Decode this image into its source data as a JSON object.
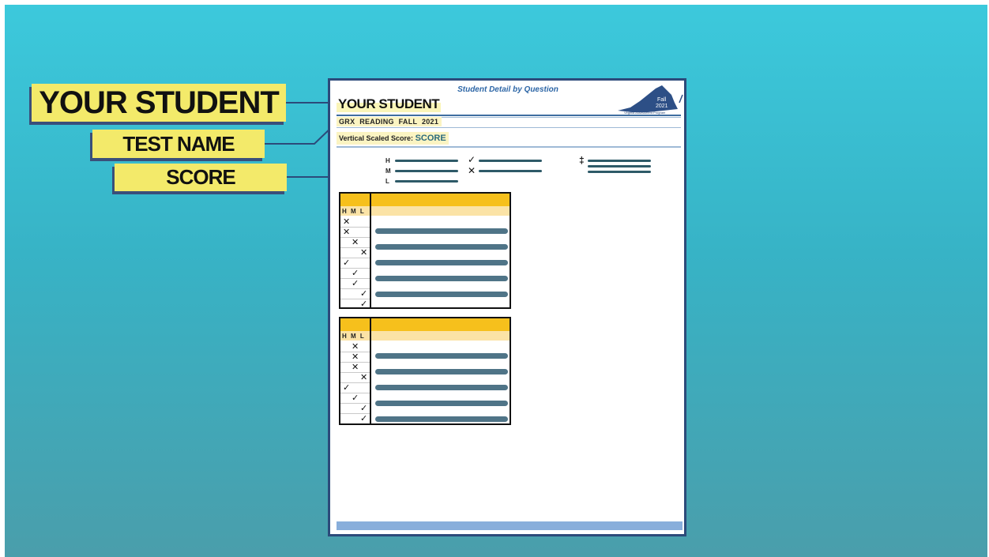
{
  "callouts": {
    "student": "YOUR STUDENT",
    "test_name": "TEST NAME",
    "score": "SCORE"
  },
  "report": {
    "title": "Student Detail by Question",
    "student_name": "YOUR STUDENT",
    "test_name": "GRX  READING  FALL 2021",
    "vertical_score_label": "Vertical Scaled Score:",
    "vertical_score_value": "SCORE",
    "logo": {
      "line1": "Fall",
      "line2": "2021",
      "caption": "Virginia Assessment Program"
    },
    "legend": {
      "levels": [
        "H",
        "M",
        "L"
      ],
      "correct_symbol": "✓",
      "incorrect_symbol": "✕",
      "dagger_symbol": "‡"
    },
    "tables": [
      {
        "header": "H M L",
        "rows": [
          {
            "level": "H",
            "mark": "incorrect"
          },
          {
            "level": "H",
            "mark": "incorrect"
          },
          {
            "level": "M",
            "mark": "incorrect"
          },
          {
            "level": "L",
            "mark": "incorrect"
          },
          {
            "level": "H",
            "mark": "correct"
          },
          {
            "level": "M",
            "mark": "correct"
          },
          {
            "level": "M",
            "mark": "correct"
          },
          {
            "level": "L",
            "mark": "correct"
          },
          {
            "level": "L",
            "mark": "correct"
          }
        ]
      },
      {
        "header": "H M L",
        "rows": [
          {
            "level": "M",
            "mark": "incorrect"
          },
          {
            "level": "M",
            "mark": "incorrect"
          },
          {
            "level": "M",
            "mark": "incorrect"
          },
          {
            "level": "L",
            "mark": "incorrect"
          },
          {
            "level": "H",
            "mark": "correct"
          },
          {
            "level": "M",
            "mark": "correct"
          },
          {
            "level": "L",
            "mark": "correct"
          },
          {
            "level": "L",
            "mark": "correct"
          }
        ]
      }
    ]
  },
  "colors": {
    "background": "#3cc9dc",
    "callout": "#f3ea6a",
    "header_gold": "#f6c01c",
    "header_light": "#fbe3a6",
    "bar": "#4f7487",
    "page_border": "#2c4a7a"
  }
}
